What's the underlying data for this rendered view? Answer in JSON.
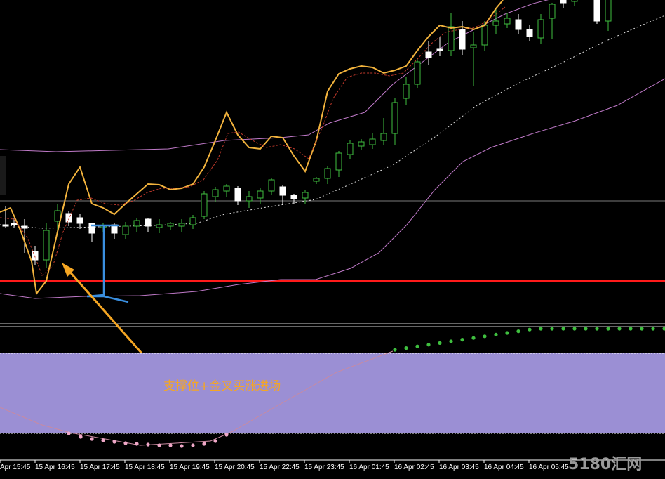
{
  "chart_data": {
    "type": "candlestick",
    "time_labels": [
      "Apr 15:45",
      "15 Apr 16:45",
      "15 Apr 17:45",
      "15 Apr 18:45",
      "15 Apr 19:45",
      "15 Apr 20:45",
      "15 Apr 22:45",
      "15 Apr 23:45",
      "16 Apr 01:45",
      "16 Apr 02:45",
      "16 Apr 03:45",
      "16 Apr 04:45",
      "16 Apr 05:45"
    ],
    "annotation": "支撑位+金叉买涨进场",
    "watermark": "5180汇网",
    "colors": {
      "background": "#000000",
      "bull_candle": "#3fbf3f",
      "bear_candle": "#ffffff",
      "fast_line": "#f2b33d",
      "slow_line": "#c0392b",
      "bollinger": "#c07ac9",
      "ma_dotted": "#dddddd",
      "support_line": "#ff1a1a",
      "bracket": "#3a8fe0",
      "arrow": "#f5a623",
      "oscillator_fill": "#9b8fd4",
      "dots_up": "#3fbf3f",
      "dots_down": "#f0a8c8"
    }
  }
}
